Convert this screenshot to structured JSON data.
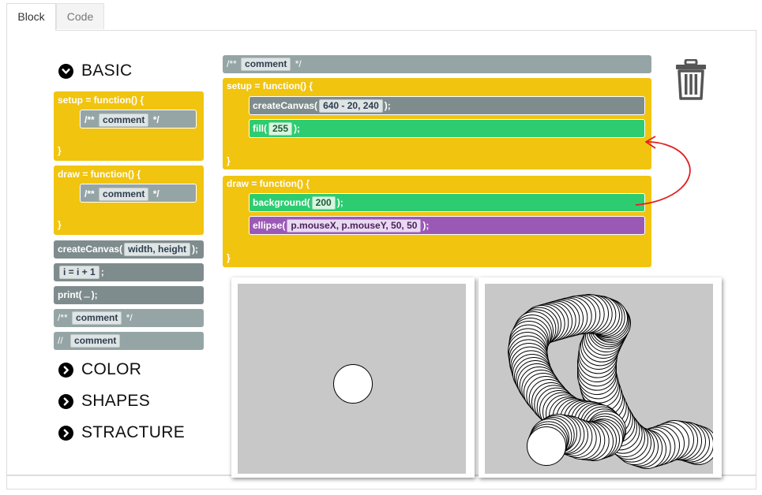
{
  "tabs": [
    {
      "label": "Block",
      "active": true
    },
    {
      "label": "Code",
      "active": false
    }
  ],
  "categories": {
    "basic": "BASIC",
    "color": "COLOR",
    "shapes": "SHAPES",
    "structure": "STRACTURE"
  },
  "palette": {
    "setup": {
      "header": "setup  =  function()  {",
      "close": "}",
      "comment_prefix": "/**",
      "comment_slot": "comment",
      "comment_suffix": "*/"
    },
    "draw": {
      "header": "draw  =  function()  {",
      "close": "}",
      "comment_prefix": "/**",
      "comment_slot": "comment",
      "comment_suffix": "*/"
    },
    "create_canvas": {
      "prefix": "createCanvas(",
      "slot": "width,  height",
      "suffix": ");"
    },
    "increment": {
      "slot": "i  =  i  +  1",
      "suffix": ";"
    },
    "print": {
      "prefix": "print(",
      "slot": "",
      "suffix": ");"
    },
    "block_comment": {
      "prefix": "/**",
      "slot": "comment",
      "suffix": "*/"
    },
    "line_comment": {
      "prefix": "//",
      "slot": "comment"
    }
  },
  "workspace": {
    "top_comment": {
      "prefix": "/**",
      "slot": "comment",
      "suffix": "*/"
    },
    "setup": {
      "header": "setup  =  function()  {",
      "close": "}",
      "create_canvas": {
        "prefix": "createCanvas(",
        "slot": "640  -  20,  240",
        "suffix": ");"
      },
      "fill": {
        "prefix": "fill(",
        "slot": "255",
        "suffix": ");"
      }
    },
    "draw": {
      "header": "draw  =  function()  {",
      "close": "}",
      "background": {
        "prefix": "background(",
        "slot": "200",
        "suffix": ");"
      },
      "ellipse": {
        "prefix": "ellipse(",
        "slot": "p.mouseX,  p.mouseY,  50,  50",
        "suffix": ");"
      }
    }
  },
  "colors": {
    "yellow": "#f1c40f",
    "gray": "#7f8c8d",
    "light_gray": "#95a5a6",
    "green": "#2ecc71",
    "purple": "#9b59b6",
    "canvas_bg": "#c8c8c8",
    "arrow": "#e02020"
  },
  "icons": {
    "expand_basic": "chevron-down-icon",
    "expand_other": "chevron-right-icon",
    "trash": "trash-icon"
  }
}
